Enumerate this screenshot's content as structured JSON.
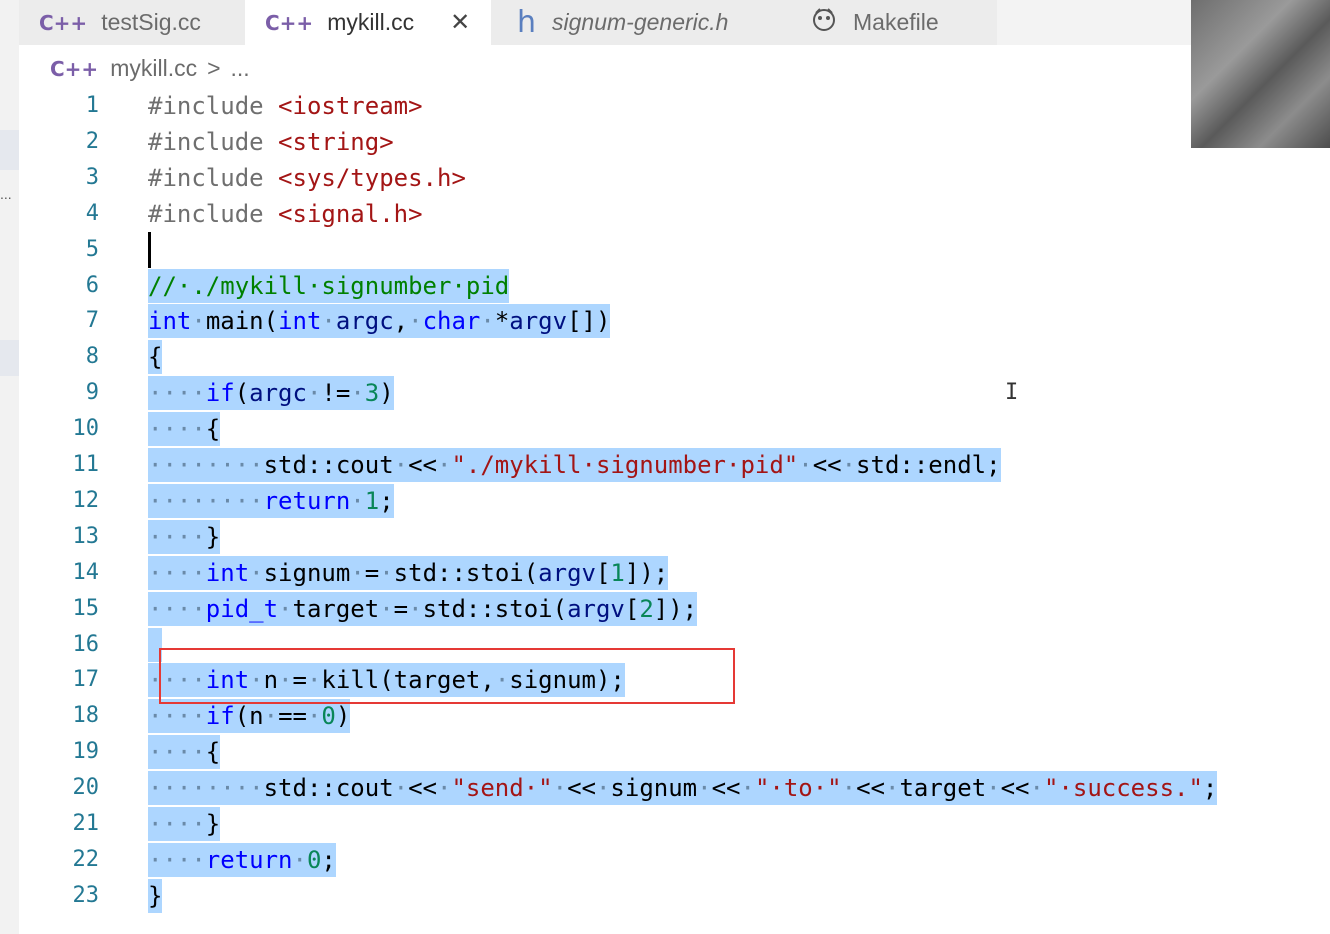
{
  "tabs": [
    {
      "icon": "C++",
      "label": "testSig.cc",
      "active": false
    },
    {
      "icon": "C++",
      "label": "mykill.cc",
      "active": true,
      "close": "✕"
    },
    {
      "icon": "h",
      "label": "signum-generic.h",
      "active": false
    },
    {
      "icon": "gnu",
      "label": "Makefile",
      "active": false
    }
  ],
  "breadcrumb": {
    "file": "mykill.cc",
    "sep": ">",
    "rest": "..."
  },
  "cursor_glyph": "I",
  "sidebar_dots": "...",
  "colors": {
    "selection": "#add6ff",
    "keyword": "#0000ff",
    "string": "#a31515",
    "comment": "#008000",
    "highlight_box": "#e53935",
    "line_number": "#237893"
  },
  "code": [
    {
      "n": "1",
      "tokens": [
        [
          "pp",
          "#include "
        ],
        [
          "str",
          "<iostream>"
        ]
      ],
      "sel": false
    },
    {
      "n": "2",
      "tokens": [
        [
          "pp",
          "#include "
        ],
        [
          "str",
          "<string>"
        ]
      ],
      "sel": false
    },
    {
      "n": "3",
      "tokens": [
        [
          "pp",
          "#include "
        ],
        [
          "str",
          "<sys/types.h>"
        ]
      ],
      "sel": false
    },
    {
      "n": "4",
      "tokens": [
        [
          "pp",
          "#include "
        ],
        [
          "str",
          "<signal.h>"
        ]
      ],
      "sel": false
    },
    {
      "n": "5",
      "tokens": [],
      "sel": false,
      "caret": true
    },
    {
      "n": "6",
      "tokens": [
        [
          "com",
          "//·./mykill·signumber·pid"
        ]
      ],
      "sel": true
    },
    {
      "n": "7",
      "tokens": [
        [
          "kw",
          "int"
        ],
        [
          "ws",
          "·"
        ],
        [
          "txt",
          "main("
        ],
        [
          "kw",
          "int"
        ],
        [
          "ws",
          "·"
        ],
        [
          "var",
          "argc"
        ],
        [
          "txt",
          ","
        ],
        [
          "ws",
          "·"
        ],
        [
          "kw",
          "char"
        ],
        [
          "ws",
          "·"
        ],
        [
          "txt",
          "*"
        ],
        [
          "var",
          "argv"
        ],
        [
          "txt",
          "[])"
        ]
      ],
      "sel": true
    },
    {
      "n": "8",
      "tokens": [
        [
          "txt",
          "{"
        ]
      ],
      "sel": true
    },
    {
      "n": "9",
      "tokens": [
        [
          "ws",
          "····"
        ],
        [
          "kw",
          "if"
        ],
        [
          "txt",
          "("
        ],
        [
          "var",
          "argc"
        ],
        [
          "ws",
          "·"
        ],
        [
          "txt",
          "!="
        ],
        [
          "ws",
          "·"
        ],
        [
          "num",
          "3"
        ],
        [
          "txt",
          ")"
        ]
      ],
      "sel": true
    },
    {
      "n": "10",
      "tokens": [
        [
          "ws",
          "····"
        ],
        [
          "txt",
          "{"
        ]
      ],
      "sel": true
    },
    {
      "n": "11",
      "tokens": [
        [
          "ws",
          "········"
        ],
        [
          "txt",
          "std::cout"
        ],
        [
          "ws",
          "·"
        ],
        [
          "txt",
          "<<"
        ],
        [
          "ws",
          "·"
        ],
        [
          "str",
          "\"./mykill·signumber·pid\""
        ],
        [
          "ws",
          "·"
        ],
        [
          "txt",
          "<<"
        ],
        [
          "ws",
          "·"
        ],
        [
          "txt",
          "std::endl;"
        ]
      ],
      "sel": true
    },
    {
      "n": "12",
      "tokens": [
        [
          "ws",
          "········"
        ],
        [
          "kw",
          "return"
        ],
        [
          "ws",
          "·"
        ],
        [
          "num",
          "1"
        ],
        [
          "txt",
          ";"
        ]
      ],
      "sel": true
    },
    {
      "n": "13",
      "tokens": [
        [
          "ws",
          "····"
        ],
        [
          "txt",
          "}"
        ]
      ],
      "sel": true
    },
    {
      "n": "14",
      "tokens": [
        [
          "ws",
          "····"
        ],
        [
          "kw",
          "int"
        ],
        [
          "ws",
          "·"
        ],
        [
          "txt",
          "signum"
        ],
        [
          "ws",
          "·"
        ],
        [
          "txt",
          "="
        ],
        [
          "ws",
          "·"
        ],
        [
          "txt",
          "std::stoi("
        ],
        [
          "var",
          "argv"
        ],
        [
          "txt",
          "["
        ],
        [
          "num",
          "1"
        ],
        [
          "txt",
          "]);"
        ]
      ],
      "sel": true
    },
    {
      "n": "15",
      "tokens": [
        [
          "ws",
          "····"
        ],
        [
          "kw",
          "pid_t"
        ],
        [
          "ws",
          "·"
        ],
        [
          "txt",
          "target"
        ],
        [
          "ws",
          "·"
        ],
        [
          "txt",
          "="
        ],
        [
          "ws",
          "·"
        ],
        [
          "txt",
          "std::stoi("
        ],
        [
          "var",
          "argv"
        ],
        [
          "txt",
          "["
        ],
        [
          "num",
          "2"
        ],
        [
          "txt",
          "]);"
        ]
      ],
      "sel": true
    },
    {
      "n": "16",
      "tokens": [
        [
          "txt",
          " "
        ]
      ],
      "sel": true
    },
    {
      "n": "17",
      "tokens": [
        [
          "ws",
          "····"
        ],
        [
          "kw",
          "int"
        ],
        [
          "ws",
          "·"
        ],
        [
          "txt",
          "n"
        ],
        [
          "ws",
          "·"
        ],
        [
          "txt",
          "="
        ],
        [
          "ws",
          "·"
        ],
        [
          "txt",
          "kill(target,"
        ],
        [
          "ws",
          "·"
        ],
        [
          "txt",
          "signum);"
        ]
      ],
      "sel": true
    },
    {
      "n": "18",
      "tokens": [
        [
          "ws",
          "····"
        ],
        [
          "kw",
          "if"
        ],
        [
          "txt",
          "(n"
        ],
        [
          "ws",
          "·"
        ],
        [
          "txt",
          "=="
        ],
        [
          "ws",
          "·"
        ],
        [
          "num",
          "0"
        ],
        [
          "txt",
          ")"
        ]
      ],
      "sel": true
    },
    {
      "n": "19",
      "tokens": [
        [
          "ws",
          "····"
        ],
        [
          "txt",
          "{"
        ]
      ],
      "sel": true
    },
    {
      "n": "20",
      "tokens": [
        [
          "ws",
          "········"
        ],
        [
          "txt",
          "std::cout"
        ],
        [
          "ws",
          "·"
        ],
        [
          "txt",
          "<<"
        ],
        [
          "ws",
          "·"
        ],
        [
          "str",
          "\"send·\""
        ],
        [
          "ws",
          "·"
        ],
        [
          "txt",
          "<<"
        ],
        [
          "ws",
          "·"
        ],
        [
          "txt",
          "signum"
        ],
        [
          "ws",
          "·"
        ],
        [
          "txt",
          "<<"
        ],
        [
          "ws",
          "·"
        ],
        [
          "str",
          "\"·to·\""
        ],
        [
          "ws",
          "·"
        ],
        [
          "txt",
          "<<"
        ],
        [
          "ws",
          "·"
        ],
        [
          "txt",
          "target"
        ],
        [
          "ws",
          "·"
        ],
        [
          "txt",
          "<<"
        ],
        [
          "ws",
          "·"
        ],
        [
          "str",
          "\"·success.\""
        ],
        [
          "txt",
          ";"
        ]
      ],
      "sel": true
    },
    {
      "n": "21",
      "tokens": [
        [
          "ws",
          "····"
        ],
        [
          "txt",
          "}"
        ]
      ],
      "sel": true
    },
    {
      "n": "22",
      "tokens": [
        [
          "ws",
          "····"
        ],
        [
          "kw",
          "return"
        ],
        [
          "ws",
          "·"
        ],
        [
          "num",
          "0"
        ],
        [
          "txt",
          ";"
        ]
      ],
      "sel": true
    },
    {
      "n": "23",
      "tokens": [
        [
          "txt",
          "}"
        ]
      ],
      "sel": true
    }
  ]
}
